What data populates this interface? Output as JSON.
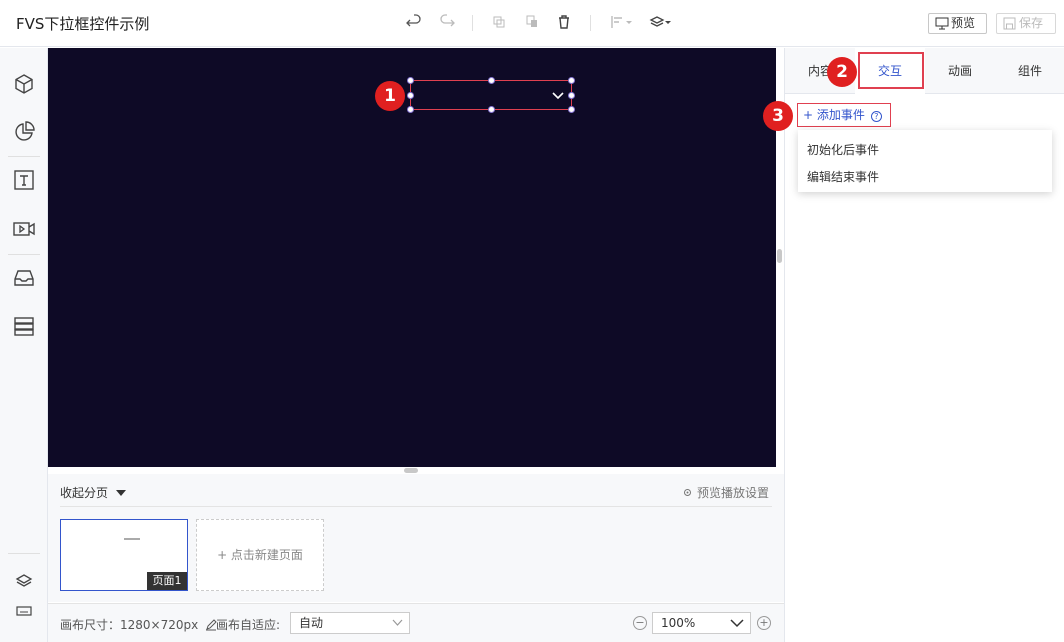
{
  "app": {
    "title": "FVS下拉框控件示例",
    "preview_label": "预览",
    "save_label": "保存"
  },
  "callouts": [
    "1",
    "2",
    "3"
  ],
  "pages_panel": {
    "title": "收起分页",
    "settings_label": "预览播放设置",
    "page_tag": "页面1",
    "new_page_label": "+ 点击新建页面"
  },
  "footer": {
    "size_label": "画布尺寸：1280×720px",
    "adapt_label": "画布自适应:",
    "adapt_value": "自动",
    "zoom_value": "100%"
  },
  "right_panel": {
    "tabs": [
      "内容",
      "交互",
      "动画",
      "组件"
    ],
    "add_event_label": "+ 添加事件",
    "event_menu": [
      "初始化后事件",
      "编辑结束事件"
    ]
  },
  "colors": {
    "canvas_bg": "#0e0a26",
    "accent": "#3355cc",
    "highlight": "#e04050",
    "badge": "#e02020"
  }
}
